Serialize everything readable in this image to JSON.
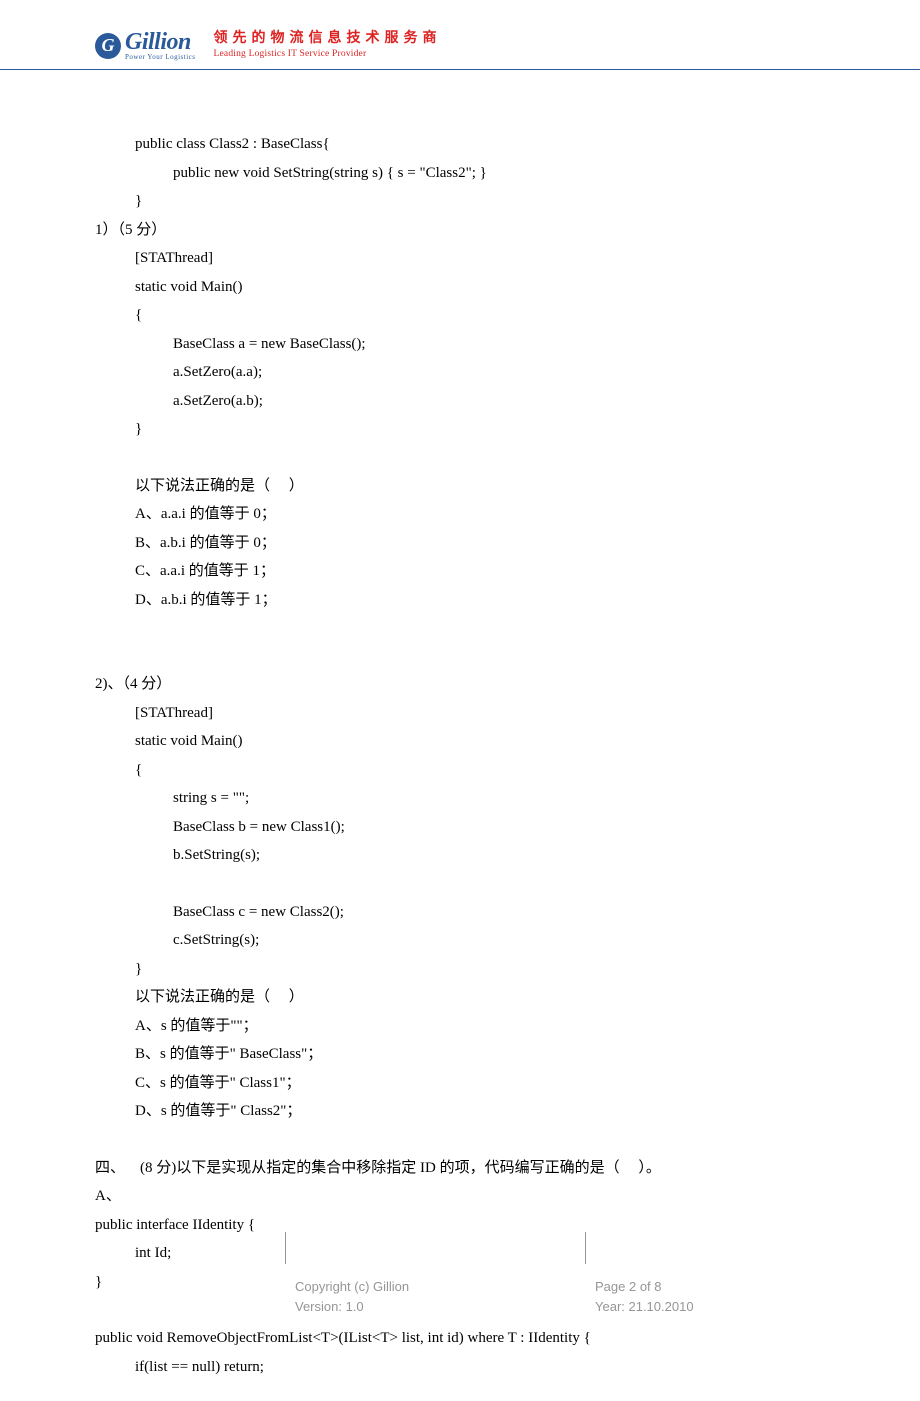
{
  "header": {
    "logo_text": "Gillion",
    "logo_sub": "Power Your Logistics",
    "tagline_cn": "领先的物流信息技术服务商",
    "tagline_en": "Leading Logistics IT Service Provider"
  },
  "body": {
    "code_top_1": "public class Class2 : BaseClass{",
    "code_top_2": "public new void SetString(string s) { s = \"Class2\"; }",
    "code_top_3": "}",
    "q1_header": "1）（5 分）",
    "q1_code_1": "[STAThread]",
    "q1_code_2": "static void Main()",
    "q1_code_3": "{",
    "q1_code_4": "BaseClass a = new BaseClass();",
    "q1_code_5": "a.SetZero(a.a);",
    "q1_code_6": "a.SetZero(a.b);",
    "q1_code_7": "}",
    "q1_prompt": "以下说法正确的是（     ）",
    "q1_a": "A、a.a.i 的值等于 0；",
    "q1_b": "B、a.b.i 的值等于 0；",
    "q1_c": "C、a.a.i 的值等于 1；",
    "q1_d": "D、a.b.i 的值等于 1；",
    "q2_header": "2)、（4 分）",
    "q2_code_1": "[STAThread]",
    "q2_code_2": "static void Main()",
    "q2_code_3": "{",
    "q2_code_4": "string s = \"\";",
    "q2_code_5": "BaseClass b = new Class1();",
    "q2_code_6": "b.SetString(s);",
    "q2_code_7": "BaseClass c = new Class2();",
    "q2_code_8": "c.SetString(s);",
    "q2_code_9": "}",
    "q2_prompt": "以下说法正确的是（     ）",
    "q2_a": "A、s 的值等于\"\"；",
    "q2_b": "B、s 的值等于\" BaseClass\"；",
    "q2_c": "C、s 的值等于\" Class1\"；",
    "q2_d": "D、s 的值等于\" Class2\"；",
    "q4_header": "四、    (8 分)以下是实现从指定的集合中移除指定 ID 的项，代码编写正确的是（     ）。",
    "q4_a_label": "A、",
    "q4_code_1": "public interface IIdentity {",
    "q4_code_2": "int Id;",
    "q4_code_3": "}",
    "q4_code_4": "public void RemoveObjectFromList<T>(IList<T> list, int id) where T : IIdentity {",
    "q4_code_5": "if(list == null) return;"
  },
  "footer": {
    "copyright": "Copyright (c) Gillion",
    "version": "Version: 1.0",
    "page": "Page 2 of 8",
    "year": "Year: 21.10.2010"
  }
}
